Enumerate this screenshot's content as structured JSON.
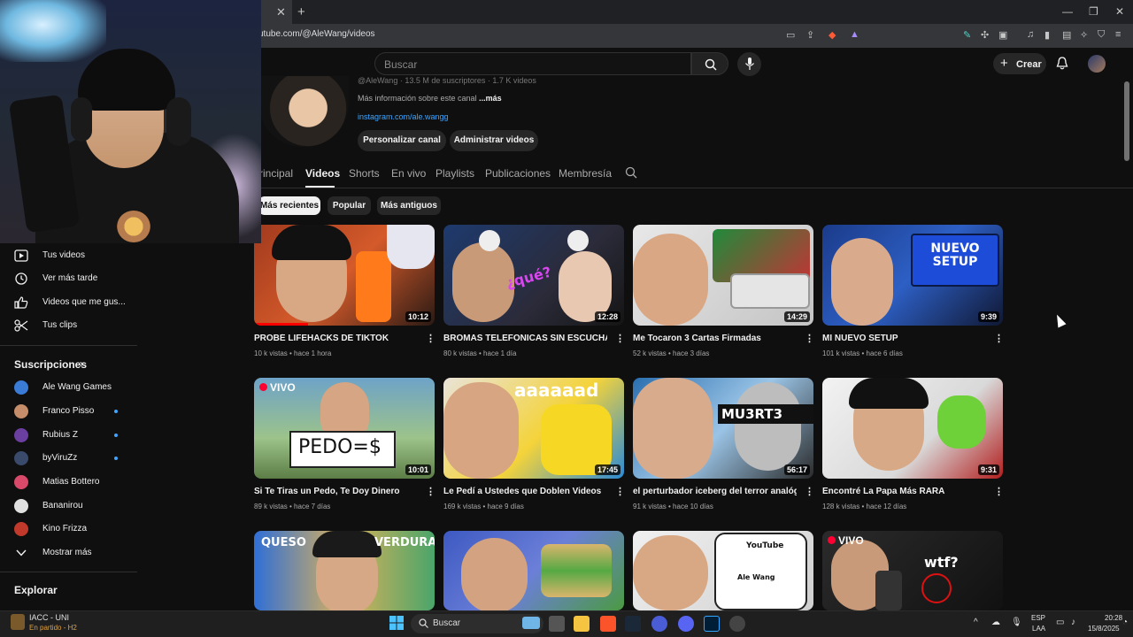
{
  "browser": {
    "url": "utube.com/@AleWang/videos",
    "tab_close": "✕",
    "new_tab": "+"
  },
  "header": {
    "search_placeholder": "Buscar",
    "create_label": "Crear"
  },
  "channel": {
    "handle": "@AleWang · 13.5 M de suscriptores · 1.7 K videos",
    "info_text": "Más información sobre este canal",
    "info_more": "...más",
    "link": "instagram.com/ale.wangg",
    "buttons": [
      "Personalizar canal",
      "Administrar videos"
    ],
    "tabs": [
      "Principal",
      "Videos",
      "Shorts",
      "En vivo",
      "Playlists",
      "Publicaciones",
      "Membresía"
    ],
    "active_tab": "Videos",
    "chips": [
      "Más recientes",
      "Popular",
      "Más antiguos"
    ]
  },
  "sidebar": {
    "items": [
      {
        "label": "Tus videos",
        "icon": "play-icon"
      },
      {
        "label": "Ver más tarde",
        "icon": "clock-icon"
      },
      {
        "label": "Videos que me gus...",
        "icon": "thumb-up-icon"
      },
      {
        "label": "Tus clips",
        "icon": "scissors-icon"
      }
    ],
    "subscriptions_heading": "Suscripciones",
    "subscriptions": [
      {
        "label": "Ale Wang Games",
        "color": "#3a7bd5",
        "dot": false
      },
      {
        "label": "Franco Pisso",
        "color": "#c58d6a",
        "dot": true
      },
      {
        "label": "Rubius Z",
        "color": "#6b3fa0",
        "dot": true
      },
      {
        "label": "byViruZz",
        "color": "#3a4a6b",
        "dot": true
      },
      {
        "label": "Matias Bottero",
        "color": "#d94a6a",
        "dot": false
      },
      {
        "label": "Bananirou",
        "color": "#e0e0e0",
        "dot": false
      },
      {
        "label": "Kino Frizza",
        "color": "#c0392b",
        "dot": false
      }
    ],
    "show_more": "Mostrar más",
    "explore_heading": "Explorar"
  },
  "videos": [
    {
      "title": "PROBÉ LIFEHACKS DE TIKTOK",
      "meta": "10 k vistas • hace 1 hora",
      "duration": "10:12",
      "progress": 0.3,
      "live": false
    },
    {
      "title": "BROMAS TELEFONICAS SIN ESCUCHAR",
      "meta": "80 k vistas • hace 1 día",
      "duration": "12:28",
      "progress": 0,
      "live": false
    },
    {
      "title": "Me Tocaron 3 Cartas Firmadas",
      "meta": "52 k vistas • hace 3 días",
      "duration": "14:29",
      "progress": 0,
      "live": false
    },
    {
      "title": "MI NUEVO SETUP",
      "meta": "101 k vistas • hace 6 días",
      "duration": "9:39",
      "progress": 0,
      "live": false
    },
    {
      "title": "Si Te Tiras un Pedo, Te Doy Dinero",
      "meta": "89 k vistas • hace 7 días",
      "duration": "10:01",
      "progress": 0,
      "live": true
    },
    {
      "title": "Le Pedí a Ustedes que Doblen Videos",
      "meta": "169 k vistas • hace 9 días",
      "duration": "17:45",
      "progress": 0,
      "live": false
    },
    {
      "title": "el perturbador iceberg del terror analógico",
      "meta": "91 k vistas • hace 10 días",
      "duration": "56:17",
      "progress": 0,
      "live": false
    },
    {
      "title": "Encontré La Papa Más RARA",
      "meta": "128 k vistas • hace 12 días",
      "duration": "9:31",
      "progress": 0,
      "live": false
    }
  ],
  "thumb_text": {
    "v2": "¿qué?",
    "v4": "NUEVO SETUP",
    "v5": "PEDO=$",
    "v6": "aaaaaad",
    "v7": "MU3RT3",
    "r3a": "QUESO",
    "r3b": "VERDURA",
    "r3c": "YouTube",
    "r3d": "Ale Wang",
    "r3e": "wtf?",
    "live_label": "VIVO"
  },
  "taskbar": {
    "game": "IACC - UNI",
    "game_status": "En partido - H2",
    "search": "Buscar",
    "lang": "ESP",
    "lang2": "LAA",
    "time": "20:28",
    "date": "15/8/2025"
  }
}
